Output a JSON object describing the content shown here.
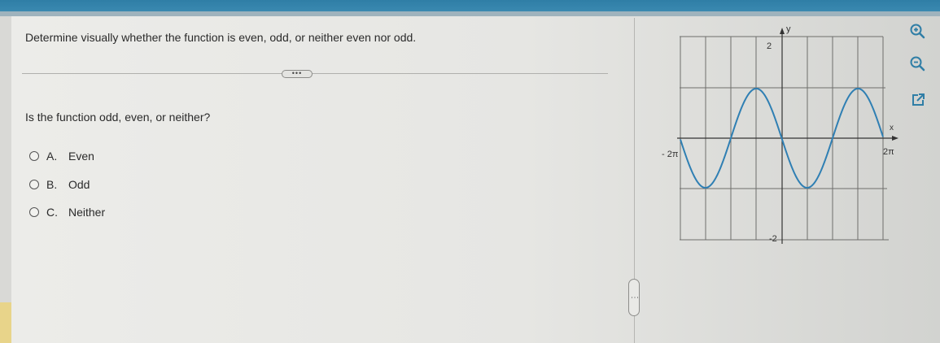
{
  "question": {
    "prompt": "Determine visually whether the function is even, odd, or neither even nor odd.",
    "more_label": "•••",
    "subquestion": "Is the function odd, even, or neither?",
    "options": [
      {
        "letter": "A.",
        "label": "Even"
      },
      {
        "letter": "B.",
        "label": "Odd"
      },
      {
        "letter": "C.",
        "label": "Neither"
      }
    ]
  },
  "graph": {
    "y_axis_label": "y",
    "x_axis_label": "x",
    "y_max_label": "2",
    "y_min_label": "-2",
    "x_min_label": "- 2π",
    "x_max_label": "2π",
    "curve_color": "#2f7fb3"
  },
  "tools": {
    "icons": [
      "zoom-in-icon",
      "zoom-out-icon",
      "open-external-icon"
    ],
    "icon_color": "#2f7ea6"
  },
  "split_handle_label": "⋮"
}
